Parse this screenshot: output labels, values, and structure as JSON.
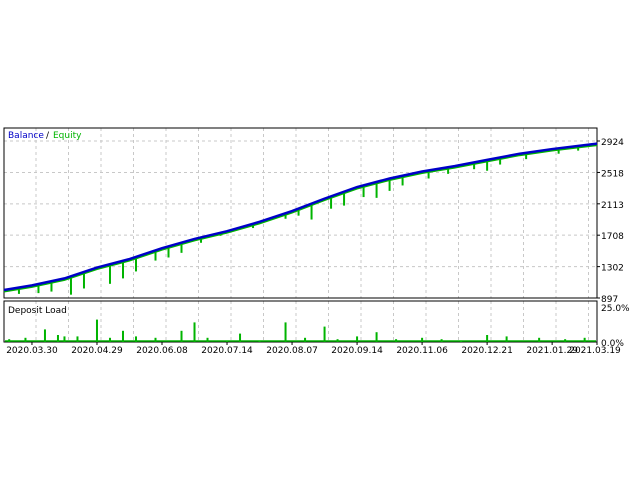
{
  "chart_data": [
    {
      "type": "line",
      "title": "Balance / Equity",
      "legend": [
        {
          "name": "Balance",
          "color": "#0000c8"
        },
        {
          "name": "Equity",
          "color": "#00b400"
        }
      ],
      "legend_separator": "/",
      "ylim": [
        897,
        2924
      ],
      "y_ticks": [
        "2924",
        "2518",
        "2113",
        "1708",
        "1302",
        "897"
      ],
      "y_tick_values": [
        2924,
        2518,
        2113,
        1708,
        1302,
        897
      ],
      "xlim": [
        -0.43,
        8.69
      ],
      "x_tick_labels": [
        "2020.03.30",
        "2020.04.29",
        "2020.06.08",
        "2020.07.14",
        "2020.08.07",
        "2020.09.14",
        "2020.11.06",
        "2020.12.21",
        "2021.01.29",
        "2021.03.19"
      ],
      "grid": true,
      "series": [
        {
          "name": "Balance",
          "points": [
            [
              -0.43,
              1000
            ],
            [
              0,
              1060
            ],
            [
              0.5,
              1150
            ],
            [
              1,
              1290
            ],
            [
              1.5,
              1400
            ],
            [
              2,
              1540
            ],
            [
              2.5,
              1660
            ],
            [
              3,
              1760
            ],
            [
              3.5,
              1880
            ],
            [
              4,
              2020
            ],
            [
              4.5,
              2180
            ],
            [
              5,
              2330
            ],
            [
              5.5,
              2440
            ],
            [
              6,
              2530
            ],
            [
              6.5,
              2600
            ],
            [
              7,
              2680
            ],
            [
              7.5,
              2760
            ],
            [
              8,
              2820
            ],
            [
              8.69,
              2890
            ]
          ]
        },
        {
          "name": "Equity",
          "dips": [
            [
              -0.2,
              950
            ],
            [
              0.1,
              960
            ],
            [
              0.3,
              980
            ],
            [
              0.6,
              940
            ],
            [
              0.8,
              1020
            ],
            [
              1.2,
              1080
            ],
            [
              1.4,
              1150
            ],
            [
              1.6,
              1240
            ],
            [
              1.9,
              1380
            ],
            [
              2.1,
              1420
            ],
            [
              2.3,
              1480
            ],
            [
              2.6,
              1610
            ],
            [
              2.9,
              1700
            ],
            [
              3.4,
              1800
            ],
            [
              3.9,
              1920
            ],
            [
              4.1,
              1960
            ],
            [
              4.3,
              1910
            ],
            [
              4.6,
              2050
            ],
            [
              4.8,
              2090
            ],
            [
              5.1,
              2200
            ],
            [
              5.3,
              2190
            ],
            [
              5.5,
              2280
            ],
            [
              5.7,
              2350
            ],
            [
              6.1,
              2440
            ],
            [
              6.4,
              2500
            ],
            [
              6.8,
              2560
            ],
            [
              7.0,
              2540
            ],
            [
              7.2,
              2620
            ],
            [
              7.6,
              2690
            ],
            [
              8.1,
              2760
            ],
            [
              8.4,
              2800
            ]
          ]
        }
      ]
    },
    {
      "type": "bar",
      "title": "Deposit Load",
      "color": "#00b400",
      "ylim": [
        0,
        25
      ],
      "y_ticks": [
        "25.0%",
        "0.0%"
      ],
      "bars": [
        [
          -0.35,
          2
        ],
        [
          -0.1,
          3
        ],
        [
          0.2,
          9
        ],
        [
          0.4,
          5
        ],
        [
          0.5,
          4
        ],
        [
          0.7,
          4
        ],
        [
          1.0,
          16
        ],
        [
          1.2,
          3
        ],
        [
          1.4,
          8
        ],
        [
          1.6,
          4
        ],
        [
          1.9,
          3
        ],
        [
          2.3,
          8
        ],
        [
          2.5,
          14
        ],
        [
          2.7,
          3
        ],
        [
          3.0,
          1
        ],
        [
          3.2,
          6
        ],
        [
          3.5,
          1
        ],
        [
          3.9,
          14
        ],
        [
          4.2,
          3
        ],
        [
          4.5,
          11
        ],
        [
          4.7,
          2
        ],
        [
          5.0,
          4
        ],
        [
          5.3,
          7
        ],
        [
          5.6,
          2
        ],
        [
          6.0,
          3
        ],
        [
          6.3,
          2
        ],
        [
          6.6,
          1
        ],
        [
          7.0,
          5
        ],
        [
          7.3,
          4
        ],
        [
          7.8,
          3
        ],
        [
          8.2,
          2
        ],
        [
          8.5,
          3
        ]
      ]
    }
  ]
}
